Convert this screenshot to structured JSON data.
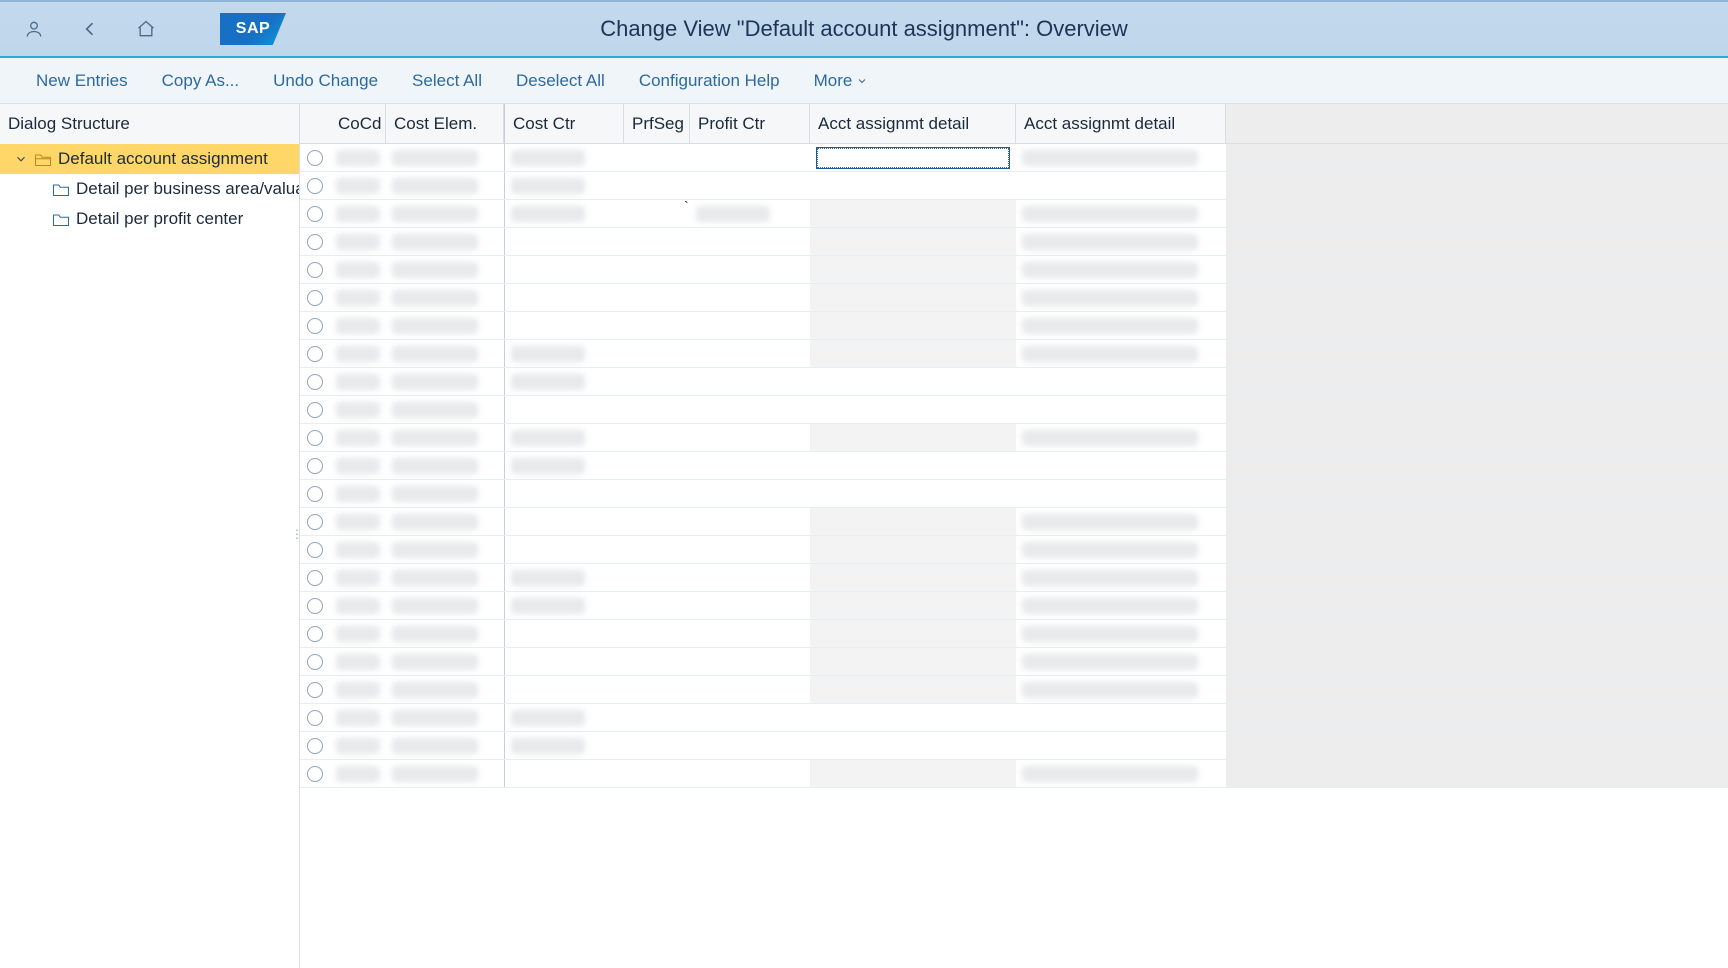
{
  "header": {
    "title": "Change View \"Default account assignment\": Overview",
    "logo_text": "SAP"
  },
  "toolbar": {
    "new_entries": "New Entries",
    "copy_as": "Copy As...",
    "undo_change": "Undo Change",
    "select_all": "Select All",
    "deselect_all": "Deselect All",
    "configuration_help": "Configuration Help",
    "more": "More"
  },
  "sidebar": {
    "header": "Dialog Structure",
    "nodes": [
      {
        "label": "Default account assignment",
        "selected": true
      },
      {
        "label": "Detail per business area/valuation area"
      },
      {
        "label": "Detail per profit center"
      }
    ]
  },
  "table": {
    "columns": {
      "sel": "",
      "cocd": "CoCd",
      "cost_elem": "Cost Elem.",
      "cost_ctr": "Cost Ctr",
      "prfseg": "PrfSeg",
      "profit_ctr": "Profit Ctr",
      "acct_detail_1": "Acct assignmt detail",
      "acct_detail_2": "Acct assignmt detail"
    },
    "rows": 23,
    "active_input_row": 0,
    "profit_ctr_tick_row": 2
  }
}
